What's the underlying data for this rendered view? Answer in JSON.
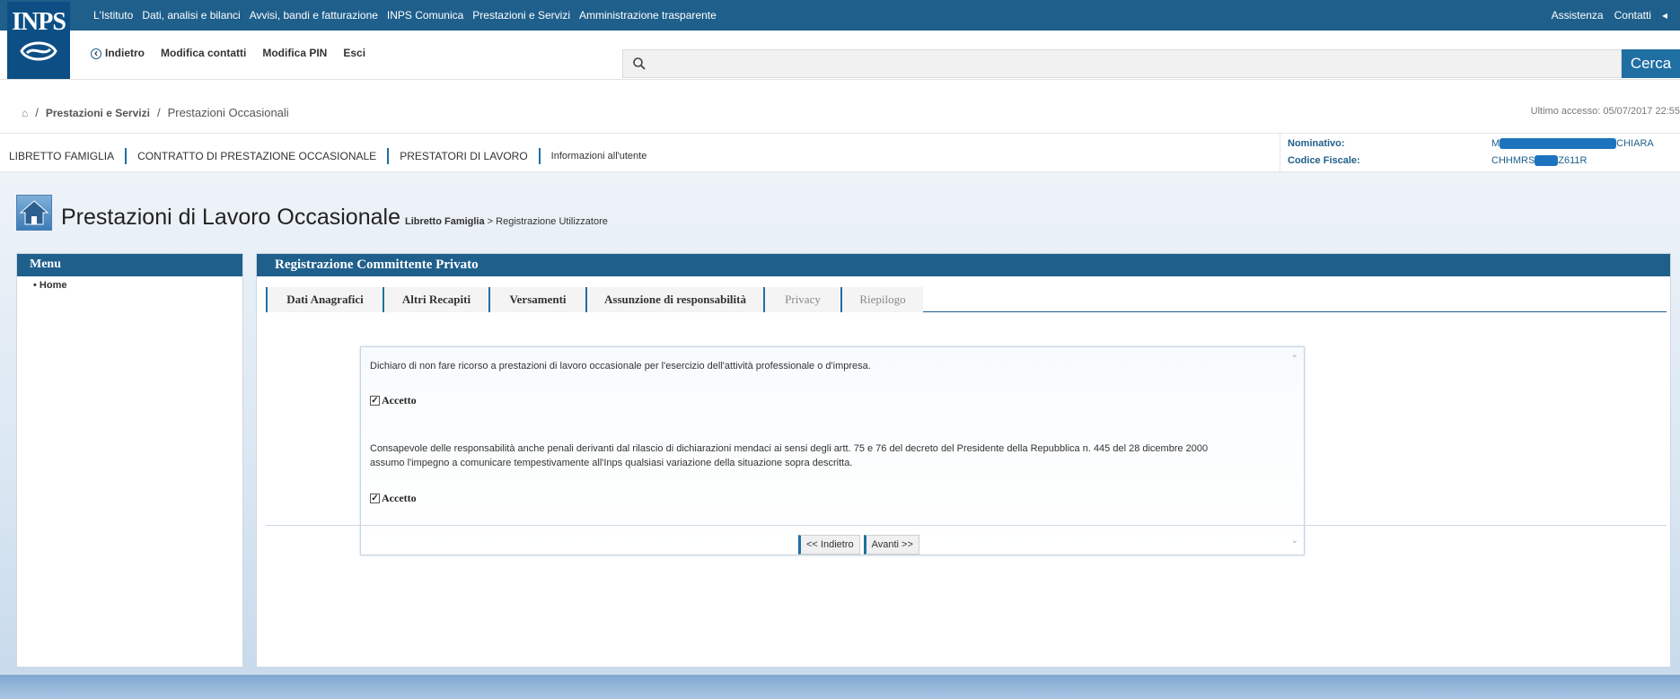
{
  "header": {
    "logo_text": "INPS",
    "top_links": [
      "L'Istituto",
      "Dati, analisi e bilanci",
      "Avvisi, bandi e fatturazione",
      "INPS Comunica",
      "Prestazioni e Servizi",
      "Amministrazione trasparente"
    ],
    "right_links": [
      "Assistenza",
      "Contatti"
    ]
  },
  "nav": {
    "back": "Indietro",
    "modifica_contatti": "Modifica contatti",
    "modifica_pin": "Modifica PIN",
    "esci": "Esci",
    "search_placeholder": "",
    "search_button": "Cerca"
  },
  "breadcrumb": {
    "item1": "Prestazioni e Servizi",
    "item2": "Prestazioni Occasionali",
    "last_access": "Ultimo accesso: 05/07/2017 22:55"
  },
  "libnav": {
    "items": [
      "LIBRETTO FAMIGLIA",
      "CONTRATTO DI PRESTAZIONE OCCASIONALE",
      "PRESTATORI DI LAVORO",
      "Informazioni all'utente"
    ]
  },
  "user": {
    "nominativo_label": "Nominativo:",
    "nominativo_start": "M",
    "nominativo_end": "CHIARA",
    "cf_label": "Codice Fiscale:",
    "cf_start": "CHHMRS",
    "cf_end": "Z611R"
  },
  "page": {
    "title": "Prestazioni di Lavoro Occasionale",
    "sub_bold": "Libretto Famiglia",
    "sub_rest": " > Registrazione Utilizzatore"
  },
  "menu": {
    "header": "Menu",
    "items": [
      "Home"
    ]
  },
  "content": {
    "header": "Registrazione Committente Privato",
    "tabs": [
      "Dati Anagrafici",
      "Altri Recapiti",
      "Versamenti",
      "Assunzione di responsabilità",
      "Privacy",
      "Riepilogo"
    ],
    "decl1": "Dichiaro di non fare ricorso a prestazioni di lavoro occasionale per l'esercizio dell'attività professionale o d'impresa.",
    "accept1": "Accetto",
    "decl2_line1": "Consapevole delle responsabilità anche penali derivanti dal rilascio di dichiarazioni mendaci ai sensi degli artt. 75 e 76 del decreto del Presidente della Repubblica n. 445 del 28 dicembre 2000",
    "decl2_line2": "assumo l'impegno a comunicare tempestivamente all'Inps qualsiasi variazione della situazione sopra descritta.",
    "accept2": "Accetto",
    "btn_back": "<< Indietro",
    "btn_next": "Avanti >>"
  },
  "colors": {
    "primary": "#1f5f8b",
    "accent": "#1f6fa3",
    "redaction": "#1e73be"
  }
}
